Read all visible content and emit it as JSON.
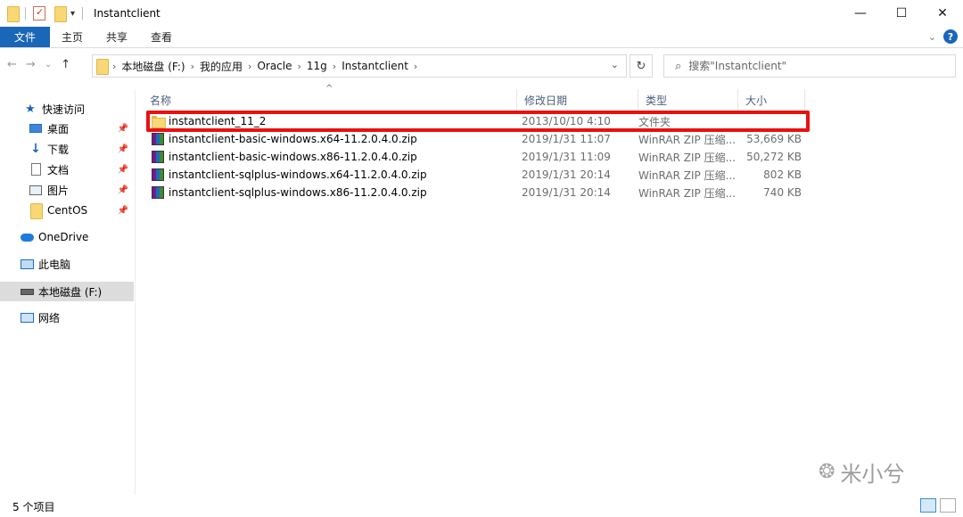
{
  "window": {
    "title": "Instantclient",
    "minimize": "—",
    "maximize": "☐",
    "close": "✕"
  },
  "ribbon": {
    "tabs": [
      "文件",
      "主页",
      "共享",
      "查看"
    ],
    "expand": "⌄",
    "help": "?"
  },
  "nav": {
    "back": "←",
    "forward": "→",
    "recent": "⌄",
    "up": "↑"
  },
  "address": {
    "crumbs": [
      "本地磁盘 (F:)",
      "我的应用",
      "Oracle",
      "11g",
      "Instantclient"
    ],
    "dropdown": "⌄",
    "refresh": "↻"
  },
  "search": {
    "placeholder": "搜索\"Instantclient\""
  },
  "navpane": {
    "quick_access": "快速访问",
    "items": [
      "桌面",
      "下载",
      "文档",
      "图片",
      "CentOS"
    ],
    "onedrive": "OneDrive",
    "this_pc": "此电脑",
    "local_disk": "本地磁盘 (F:)",
    "network": "网络"
  },
  "columns": {
    "name": "名称",
    "date": "修改日期",
    "type": "类型",
    "size": "大小"
  },
  "files": [
    {
      "name": "instantclient_11_2",
      "date": "2013/10/10 4:10",
      "type": "文件夹",
      "size": "",
      "icon": "folder-icon",
      "highlighted": true
    },
    {
      "name": "instantclient-basic-windows.x64-11.2.0.4.0.zip",
      "date": "2019/1/31 11:07",
      "type": "WinRAR ZIP 压缩...",
      "size": "53,669 KB",
      "icon": "winrar-zip-icon"
    },
    {
      "name": "instantclient-basic-windows.x86-11.2.0.4.0.zip",
      "date": "2019/1/31 11:09",
      "type": "WinRAR ZIP 压缩...",
      "size": "50,272 KB",
      "icon": "winrar-zip-icon"
    },
    {
      "name": "instantclient-sqlplus-windows.x64-11.2.0.4.0.zip",
      "date": "2019/1/31 20:14",
      "type": "WinRAR ZIP 压缩...",
      "size": "802 KB",
      "icon": "winrar-zip-icon"
    },
    {
      "name": "instantclient-sqlplus-windows.x86-11.2.0.4.0.zip",
      "date": "2019/1/31 20:14",
      "type": "WinRAR ZIP 压缩...",
      "size": "740 KB",
      "icon": "winrar-zip-icon"
    }
  ],
  "status": {
    "count": "5 个项目"
  },
  "watermark": {
    "text": "米小兮"
  },
  "colors": {
    "accent": "#1a66b8",
    "highlight_border": "#ea1010",
    "selected_nav": "#dcdcdc"
  }
}
